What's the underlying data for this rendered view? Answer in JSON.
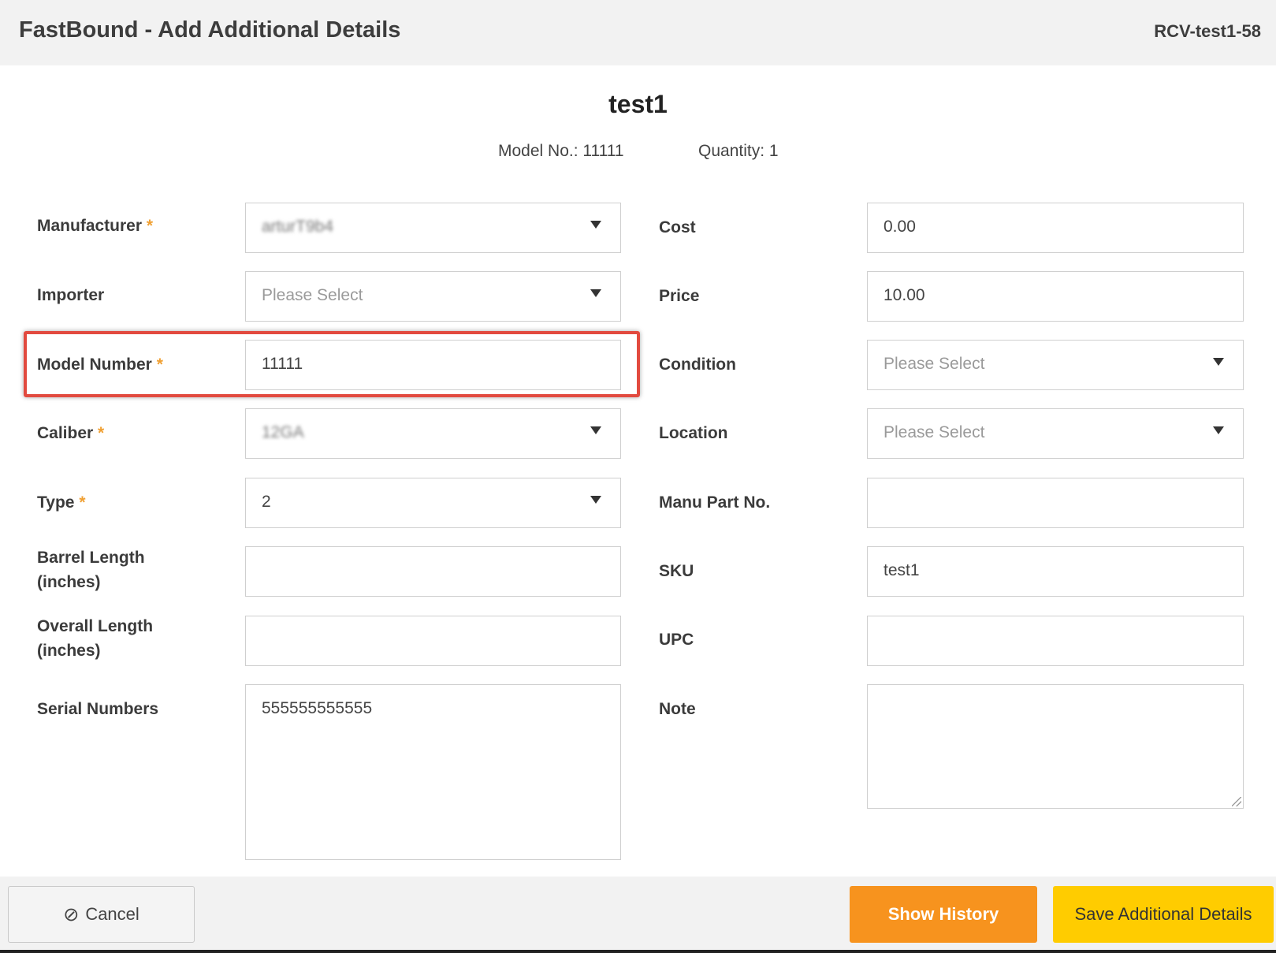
{
  "header": {
    "title": "FastBound - Add Additional Details",
    "code": "RCV-test1-58"
  },
  "item": {
    "name": "test1",
    "model_text": "Model No.: 11111",
    "quantity_text": "Quantity: 1"
  },
  "required_mark": "*",
  "left": {
    "manufacturer": {
      "label": "Manufacturer",
      "value": "arturT9b4"
    },
    "importer": {
      "label": "Importer",
      "placeholder": "Please Select"
    },
    "model_number": {
      "label": "Model Number",
      "value": "11111"
    },
    "caliber": {
      "label": "Caliber",
      "value": "12GA"
    },
    "type": {
      "label": "Type",
      "value": "2"
    },
    "barrel_length": {
      "label_line1": "Barrel Length",
      "label_line2": "(inches)",
      "value": ""
    },
    "overall_length": {
      "label_line1": "Overall Length",
      "label_line2": "(inches)",
      "value": ""
    },
    "serial_numbers": {
      "label": "Serial Numbers",
      "value": "555555555555"
    }
  },
  "right": {
    "cost": {
      "label": "Cost",
      "value": "0.00"
    },
    "price": {
      "label": "Price",
      "value": "10.00"
    },
    "condition": {
      "label": "Condition",
      "placeholder": "Please Select"
    },
    "location": {
      "label": "Location",
      "placeholder": "Please Select"
    },
    "manu_part_no": {
      "label": "Manu Part No.",
      "value": ""
    },
    "sku": {
      "label": "SKU",
      "value": "test1"
    },
    "upc": {
      "label": "UPC",
      "value": ""
    },
    "note": {
      "label": "Note",
      "value": ""
    }
  },
  "footer": {
    "cancel_label": "Cancel",
    "history_label": "Show History",
    "save_label": "Save Additional Details"
  },
  "colors": {
    "required": "#f0a033",
    "highlight": "#e24a3f",
    "history_button": "#f7931e",
    "save_button": "#ffcc00"
  }
}
